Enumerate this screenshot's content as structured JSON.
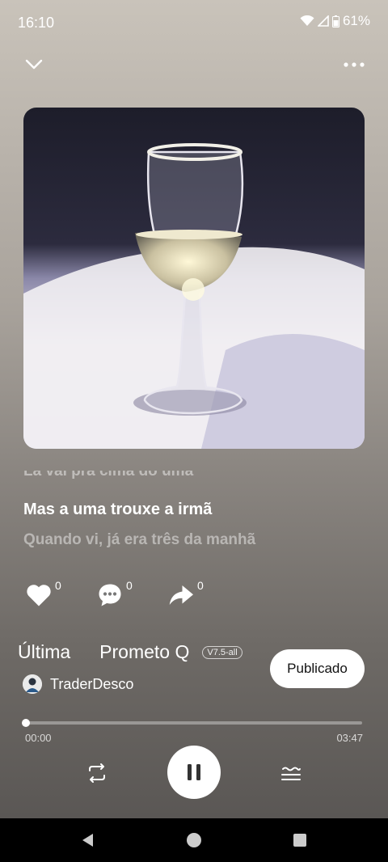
{
  "status": {
    "time": "16:10",
    "battery": "61%"
  },
  "lyrics": {
    "previous": "Lá vai pra cima do uma",
    "current": "Mas a uma trouxe a irmã",
    "next": "Quando vi, já era três da manhã"
  },
  "actions": {
    "likes": "0",
    "comments": "0",
    "shares": "0"
  },
  "track": {
    "title_part1": "Última",
    "title_part2": "Prometo Q",
    "version": "V7.5-all",
    "author": "TraderDesco"
  },
  "publish_label": "Publicado",
  "progress": {
    "current": "00:00",
    "total": "03:47",
    "fraction": 0
  },
  "icons": [
    "chevron-down-icon",
    "more-icon",
    "heart-icon",
    "comment-icon",
    "share-icon",
    "repeat-icon",
    "pause-icon",
    "queue-icon",
    "back-icon",
    "home-icon",
    "recents-icon"
  ]
}
